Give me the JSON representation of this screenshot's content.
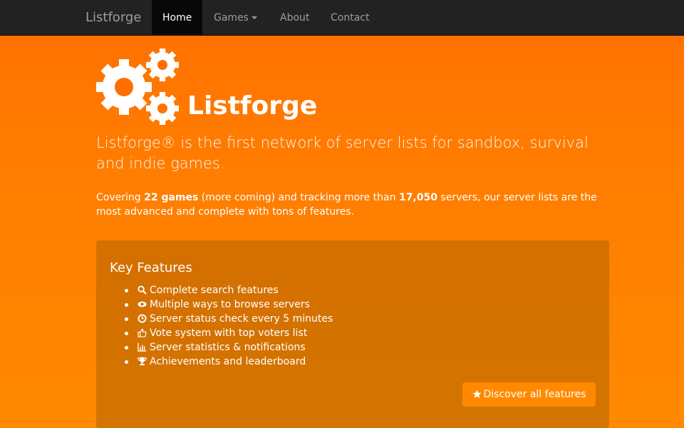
{
  "nav": {
    "brand": "Listforge",
    "items": [
      {
        "label": "Home",
        "active": true
      },
      {
        "label": "Games",
        "dropdown": true
      },
      {
        "label": "About"
      },
      {
        "label": "Contact"
      }
    ]
  },
  "hero": {
    "logo_icon": "gears-icon",
    "title": "Listforge",
    "lead": "Listforge® is the first network of server lists for sandbox, survival and indie games.",
    "intro": {
      "part1": "Covering ",
      "games_count": "22 games",
      "part2": " (more coming) and tracking more than ",
      "servers_count": "17,050",
      "part3": " servers, our server lists are the most advanced and complete with tons of features."
    }
  },
  "features": {
    "title": "Key Features",
    "items": [
      {
        "icon": "search-icon",
        "label": "Complete search features"
      },
      {
        "icon": "eye-icon",
        "label": "Multiple ways to browse servers"
      },
      {
        "icon": "clock-icon",
        "label": "Server status check every 5 minutes"
      },
      {
        "icon": "thumbs-up-icon",
        "label": "Vote system with top voters list"
      },
      {
        "icon": "bar-chart-icon",
        "label": "Server statistics & notifications"
      },
      {
        "icon": "trophy-icon",
        "label": "Achievements and leaderboard"
      }
    ],
    "button": {
      "icon": "star-icon",
      "label": "Discover all features"
    }
  },
  "colors": {
    "navbar": "#222222",
    "background_top": "#ff6f00",
    "background_bottom": "#ff8a00",
    "button": "#ff8a00"
  }
}
